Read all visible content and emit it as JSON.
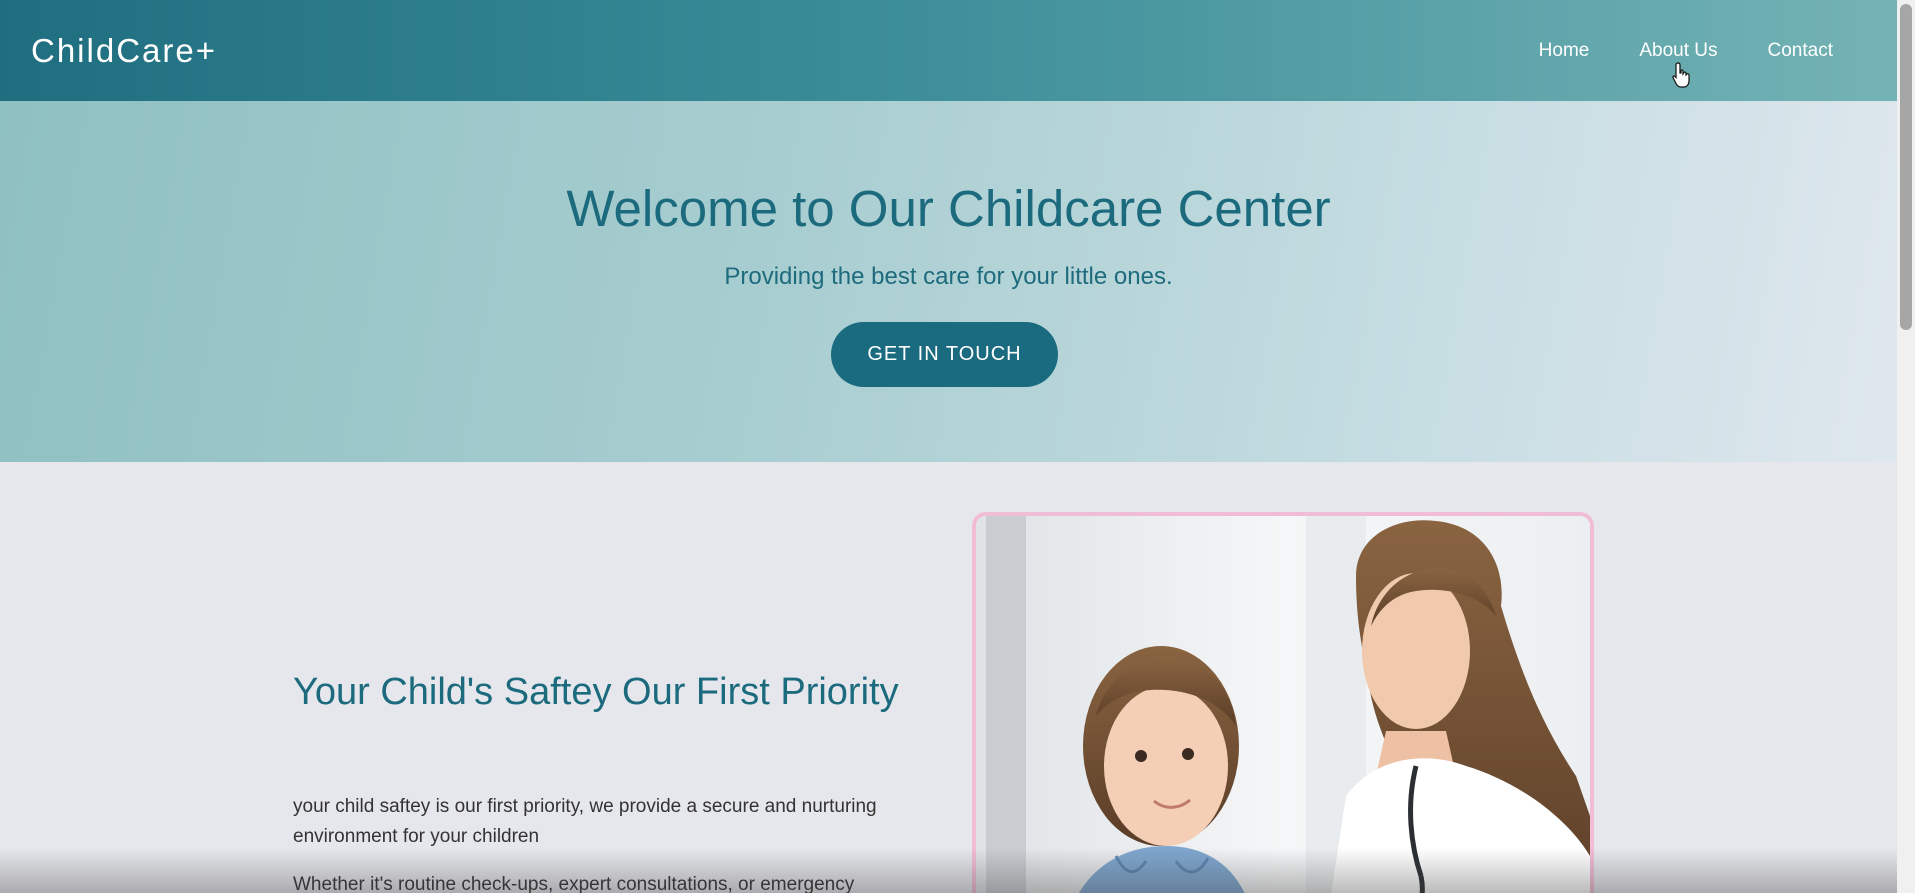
{
  "header": {
    "logo": "ChildCare+",
    "nav": {
      "home": "Home",
      "about": "About Us",
      "contact": "Contact"
    }
  },
  "hero": {
    "title": "Welcome to Our Childcare Center",
    "subtitle": "Providing the best care for your little ones.",
    "cta_label": "GET IN TOUCH"
  },
  "safety_section": {
    "heading": "Your Child's Saftey Our First Priority",
    "paragraph_1": "your child saftey is our first priority, we provide a secure and nurturing environment for your children",
    "paragraph_2": "Whether it's routine check-ups, expert consultations, or emergency",
    "image_icon": "doctor-with-child-photo"
  },
  "colors": {
    "brand": "#1c6a7d",
    "button": "#1a6b7f",
    "image_border": "#f1bcd5"
  }
}
